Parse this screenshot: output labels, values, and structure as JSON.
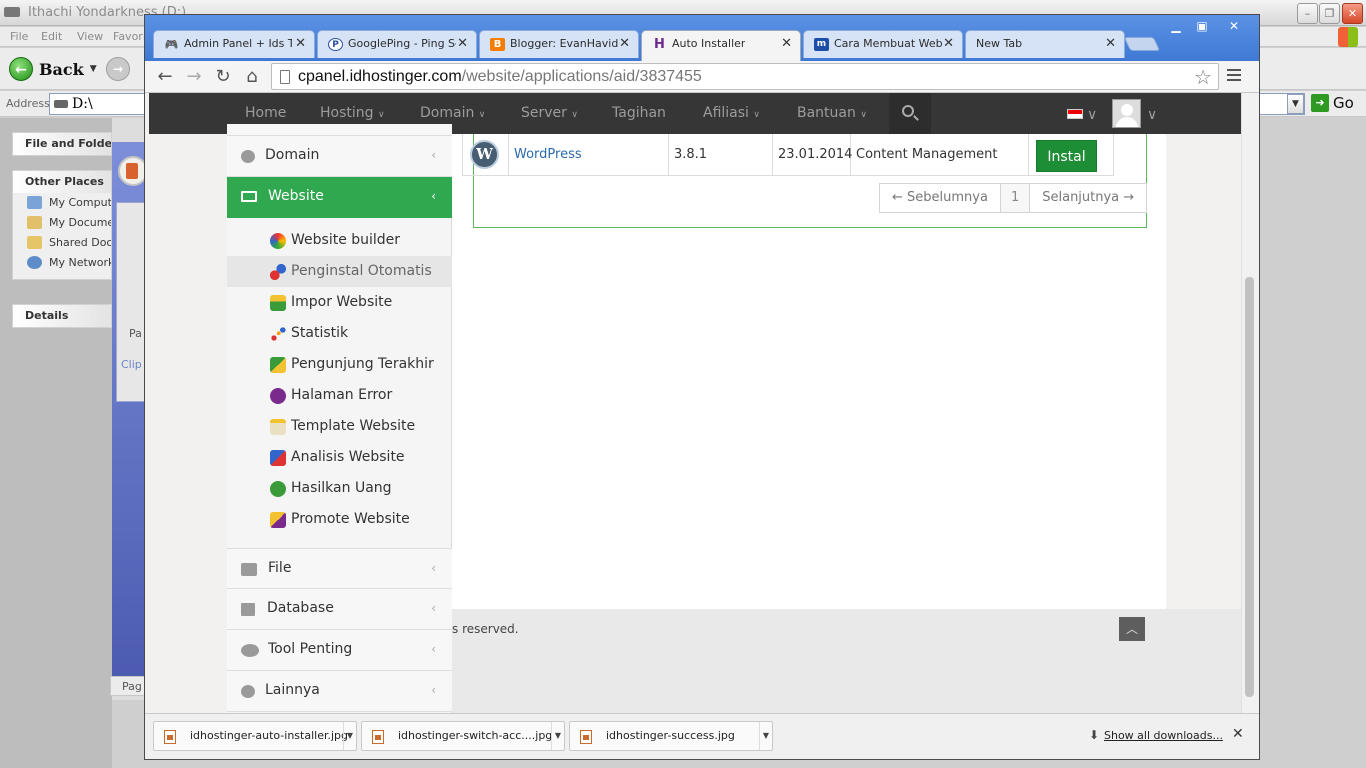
{
  "explorer": {
    "title": "Ithachi Yondarkness (D:)",
    "menu": [
      "File",
      "Edit",
      "View",
      "Favori"
    ],
    "back_label": "Back",
    "address_label": "Address",
    "address_value": "D:\\",
    "go_label": "Go",
    "tasks_header": "File and Folder Tasks",
    "other_places_header": "Other Places",
    "other_places": [
      "My Computer",
      "My Documents",
      "Shared Documents",
      "My Network Places"
    ],
    "details_header": "Details",
    "tile_label": "Pa",
    "clip_label": "Clip",
    "page_label": "Pag"
  },
  "browser": {
    "tabs": [
      {
        "label": "Admin Panel + Ids Twi",
        "icon": "gamepad-icon"
      },
      {
        "label": "GooglePing - Ping Sear",
        "icon": "p-icon"
      },
      {
        "label": "Blogger: EvanHavidz's",
        "icon": "blogger-icon"
      },
      {
        "label": "Auto Installer",
        "icon": "hostinger-icon",
        "active": true
      },
      {
        "label": "Cara Membuat Websit",
        "icon": "m-icon"
      },
      {
        "label": "New Tab",
        "icon": ""
      }
    ],
    "url_host": "cpanel.idhostinger.com",
    "url_path": "/website/applications/aid/3837455"
  },
  "site": {
    "nav": [
      {
        "label": "Home",
        "caret": ""
      },
      {
        "label": "Hosting",
        "caret": "∨"
      },
      {
        "label": "Domain",
        "caret": "∨"
      },
      {
        "label": "Server",
        "caret": "∨"
      },
      {
        "label": "Tagihan",
        "caret": ""
      },
      {
        "label": "Afiliasi",
        "caret": "∨"
      },
      {
        "label": "Bantuan",
        "caret": "∨"
      }
    ],
    "sidebar": {
      "domain": "Domain",
      "website": "Website",
      "sub": [
        "Website builder",
        "Penginstal Otomatis",
        "Impor Website",
        "Statistik",
        "Pengunjung Terakhir",
        "Halaman Error",
        "Template Website",
        "Analisis Website",
        "Hasilkan Uang",
        "Promote Website"
      ],
      "file": "File",
      "database": "Database",
      "tools": "Tool Penting",
      "more": "Lainnya",
      "chevron": "‹"
    },
    "app_row": {
      "name": "WordPress",
      "version": "3.8.1",
      "date": "23.01.2014",
      "category": "Content Management",
      "install_label": "Instal"
    },
    "pager": {
      "prev": "← Sebelumnya",
      "page": "1",
      "next": "Selanjutnya →"
    },
    "footer_text": "s reserved."
  },
  "downloads": {
    "items": [
      "idhostinger-auto-installer.jpg",
      "idhostinger-switch-acc....jpg",
      "idhostinger-success.jpg"
    ],
    "show_all": "Show all downloads..."
  }
}
